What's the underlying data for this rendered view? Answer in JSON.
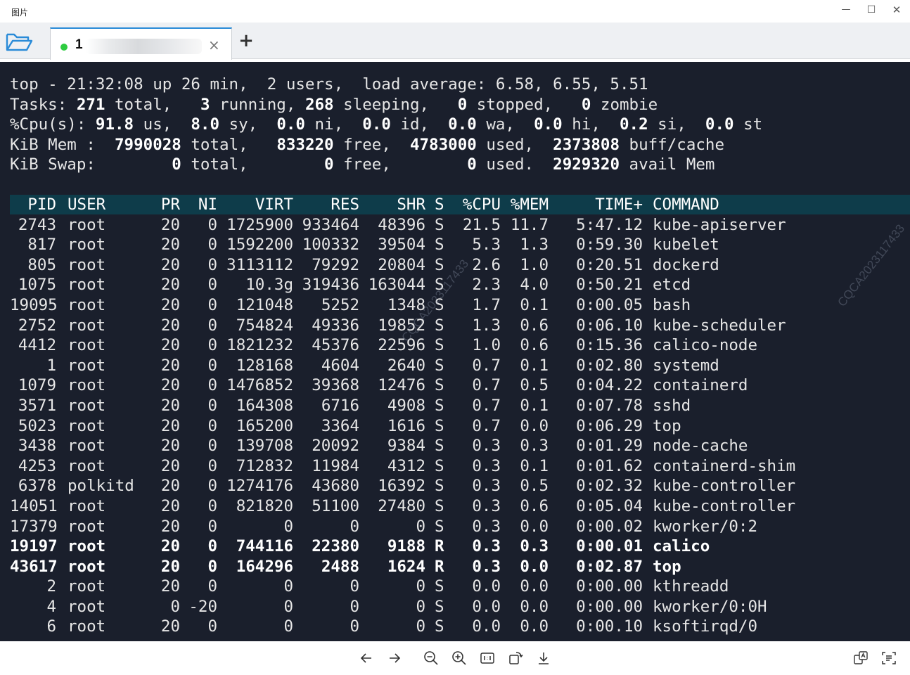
{
  "window": {
    "title": "图片",
    "minimize": "—",
    "maximize": "☐",
    "close": "✕"
  },
  "tabs": {
    "active_label": "1",
    "close_glyph": "×",
    "add_glyph": "+",
    "status_color": "#2ecc40"
  },
  "summary": [
    [
      {
        "t": "top - 21:32:08 up 26 min,  2 users,  load average: 6.58, 6.55, 5.51"
      }
    ],
    [
      {
        "t": "Tasks: "
      },
      {
        "t": "271",
        "b": 1
      },
      {
        "t": " total,   "
      },
      {
        "t": "3",
        "b": 1
      },
      {
        "t": " running, "
      },
      {
        "t": "268",
        "b": 1
      },
      {
        "t": " sleeping,   "
      },
      {
        "t": "0",
        "b": 1
      },
      {
        "t": " stopped,   "
      },
      {
        "t": "0",
        "b": 1
      },
      {
        "t": " zombie"
      }
    ],
    [
      {
        "t": "%Cpu(s): "
      },
      {
        "t": "91.8",
        "b": 1
      },
      {
        "t": " us,  "
      },
      {
        "t": "8.0",
        "b": 1
      },
      {
        "t": " sy,  "
      },
      {
        "t": "0.0",
        "b": 1
      },
      {
        "t": " ni,  "
      },
      {
        "t": "0.0",
        "b": 1
      },
      {
        "t": " id,  "
      },
      {
        "t": "0.0",
        "b": 1
      },
      {
        "t": " wa,  "
      },
      {
        "t": "0.0",
        "b": 1
      },
      {
        "t": " hi,  "
      },
      {
        "t": "0.2",
        "b": 1
      },
      {
        "t": " si,  "
      },
      {
        "t": "0.0",
        "b": 1
      },
      {
        "t": " st"
      }
    ],
    [
      {
        "t": "KiB Mem :  "
      },
      {
        "t": "7990028",
        "b": 1
      },
      {
        "t": " total,   "
      },
      {
        "t": "833220",
        "b": 1
      },
      {
        "t": " free,  "
      },
      {
        "t": "4783000",
        "b": 1
      },
      {
        "t": " used,  "
      },
      {
        "t": "2373808",
        "b": 1
      },
      {
        "t": " buff/cache"
      }
    ],
    [
      {
        "t": "KiB Swap:        "
      },
      {
        "t": "0",
        "b": 1
      },
      {
        "t": " total,        "
      },
      {
        "t": "0",
        "b": 1
      },
      {
        "t": " free,        "
      },
      {
        "t": "0",
        "b": 1
      },
      {
        "t": " used.  "
      },
      {
        "t": "2929320",
        "b": 1
      },
      {
        "t": " avail Mem"
      }
    ]
  ],
  "table": {
    "headers": [
      "PID",
      "USER",
      "PR",
      "NI",
      "VIRT",
      "RES",
      "SHR",
      "S",
      "%CPU",
      "%MEM",
      "TIME+",
      "COMMAND"
    ],
    "rows": [
      [
        "2743",
        "root",
        "20",
        "0",
        "1725900",
        "933464",
        "48396",
        "S",
        "21.5",
        "11.7",
        "5:47.12",
        "kube-apiserver"
      ],
      [
        "817",
        "root",
        "20",
        "0",
        "1592200",
        "100332",
        "39504",
        "S",
        "5.3",
        "1.3",
        "0:59.30",
        "kubelet"
      ],
      [
        "805",
        "root",
        "20",
        "0",
        "3113112",
        "79292",
        "20804",
        "S",
        "2.6",
        "1.0",
        "0:20.51",
        "dockerd"
      ],
      [
        "1075",
        "root",
        "20",
        "0",
        "10.3g",
        "319436",
        "163044",
        "S",
        "2.3",
        "4.0",
        "0:50.21",
        "etcd"
      ],
      [
        "19095",
        "root",
        "20",
        "0",
        "121048",
        "5252",
        "1348",
        "S",
        "1.7",
        "0.1",
        "0:00.05",
        "bash"
      ],
      [
        "2752",
        "root",
        "20",
        "0",
        "754824",
        "49336",
        "19852",
        "S",
        "1.3",
        "0.6",
        "0:06.10",
        "kube-scheduler"
      ],
      [
        "4412",
        "root",
        "20",
        "0",
        "1821232",
        "45376",
        "22596",
        "S",
        "1.0",
        "0.6",
        "0:15.36",
        "calico-node"
      ],
      [
        "1",
        "root",
        "20",
        "0",
        "128168",
        "4604",
        "2640",
        "S",
        "0.7",
        "0.1",
        "0:02.80",
        "systemd"
      ],
      [
        "1079",
        "root",
        "20",
        "0",
        "1476852",
        "39368",
        "12476",
        "S",
        "0.7",
        "0.5",
        "0:04.22",
        "containerd"
      ],
      [
        "3571",
        "root",
        "20",
        "0",
        "164308",
        "6716",
        "4908",
        "S",
        "0.7",
        "0.1",
        "0:07.78",
        "sshd"
      ],
      [
        "5023",
        "root",
        "20",
        "0",
        "165200",
        "3364",
        "1616",
        "S",
        "0.7",
        "0.0",
        "0:06.29",
        "top"
      ],
      [
        "3438",
        "root",
        "20",
        "0",
        "139708",
        "20092",
        "9384",
        "S",
        "0.3",
        "0.3",
        "0:01.29",
        "node-cache"
      ],
      [
        "4253",
        "root",
        "20",
        "0",
        "712832",
        "11984",
        "4312",
        "S",
        "0.3",
        "0.1",
        "0:01.62",
        "containerd-shim"
      ],
      [
        "6378",
        "polkitd",
        "20",
        "0",
        "1274176",
        "43680",
        "16392",
        "S",
        "0.3",
        "0.5",
        "0:02.32",
        "kube-controller"
      ],
      [
        "14051",
        "root",
        "20",
        "0",
        "821820",
        "51100",
        "27480",
        "S",
        "0.3",
        "0.6",
        "0:05.04",
        "kube-controller"
      ],
      [
        "17379",
        "root",
        "20",
        "0",
        "0",
        "0",
        "0",
        "S",
        "0.3",
        "0.0",
        "0:00.02",
        "kworker/0:2"
      ],
      [
        "19197",
        "root",
        "20",
        "0",
        "744116",
        "22380",
        "9188",
        "R",
        "0.3",
        "0.3",
        "0:00.01",
        "calico"
      ],
      [
        "43617",
        "root",
        "20",
        "0",
        "164296",
        "2488",
        "1624",
        "R",
        "0.3",
        "0.0",
        "0:02.87",
        "top"
      ],
      [
        "2",
        "root",
        "20",
        "0",
        "0",
        "0",
        "0",
        "S",
        "0.0",
        "0.0",
        "0:00.00",
        "kthreadd"
      ],
      [
        "4",
        "root",
        "0",
        "-20",
        "0",
        "0",
        "0",
        "S",
        "0.0",
        "0.0",
        "0:00.00",
        "kworker/0:0H"
      ],
      [
        "6",
        "root",
        "20",
        "0",
        "0",
        "0",
        "0",
        "S",
        "0.0",
        "0.0",
        "0:00.10",
        "ksoftirqd/0"
      ]
    ],
    "bold_rows": [
      16,
      17
    ]
  },
  "watermarks": [
    "CQCA2023117433",
    "CQCA2023117433"
  ],
  "colors": {
    "terminal_bg": "#1a1f2c",
    "header_bar": "#0e3c4a",
    "accent": "#2a8bd8"
  },
  "icons": {
    "folder": "folder-open-icon",
    "prev": "arrow-left-icon",
    "next": "arrow-right-icon",
    "zoom_out": "zoom-out-icon",
    "zoom_in": "zoom-in-icon",
    "actual_size": "actual-size-icon",
    "rotate": "rotate-icon",
    "download": "download-icon",
    "translate": "translate-icon",
    "ocr": "text-scan-icon"
  }
}
